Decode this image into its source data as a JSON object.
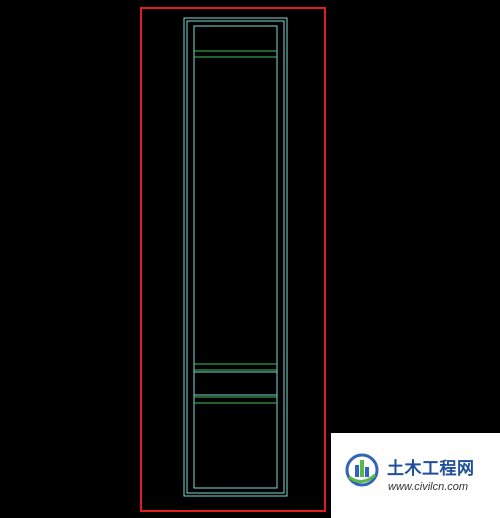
{
  "drawing": {
    "colors": {
      "background": "#000000",
      "boundary": "#e11d1d",
      "frame": "#7fd8d8",
      "rails": "#3fbf5f"
    }
  },
  "watermark": {
    "logo_icon": "building-logo-icon",
    "title": "土木工程网",
    "url": "www.civilcn.com"
  }
}
